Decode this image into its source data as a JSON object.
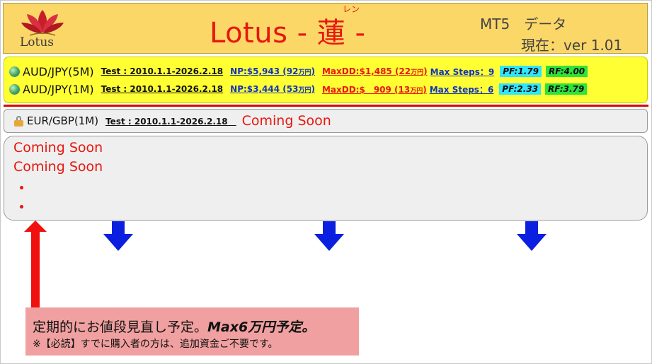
{
  "header": {
    "logo_text": "Lotus",
    "title": "Lotus - 蓮 -",
    "title_ruby": "レン",
    "platform": "MT5　データ",
    "version": "現在：ver 1.01"
  },
  "results": [
    {
      "pair": "AUD/JPY(5M)",
      "test": "Test : 2010.1.1-2026.2.18",
      "np_label": "NP:$5,943 (92",
      "np_unit": "万円",
      "np_close": ")",
      "dd_label": "MaxDD:$1,485 (22",
      "dd_unit": "万円",
      "dd_close": ")",
      "steps": "Max Steps：9",
      "pf": "PF:1.79",
      "rf": "RF:4.00"
    },
    {
      "pair": "AUD/JPY(1M)",
      "test": "Test : 2010.1.1-2026.2.18",
      "np_label": "NP:$3,444 (53",
      "np_unit": "万円",
      "np_close": ")",
      "dd_label": "MaxDD:$　909 (13",
      "dd_unit": "万円",
      "dd_close": ")",
      "steps": "Max Steps：6",
      "pf": "PF:2.33",
      "rf": "RF:3.79"
    }
  ],
  "locked": {
    "pair": "EUR/GBP(1M)",
    "test": "Test : 2010.1.1-2026.2.18　",
    "status": "Coming Soon"
  },
  "upcoming": {
    "line1": "Coming Soon",
    "line2": "Coming Soon"
  },
  "notice": {
    "text_main": "定期的にお値段見直し予定。",
    "text_bold": "Max6万円予定。",
    "text_sub": "※【必読】すでに購入者の方は、追加資金ご不要です。"
  },
  "colors": {
    "header_bg": "#fbd768",
    "title_red": "#e8160f",
    "data_bg": "#ffff33",
    "link_blue": "#1233bb",
    "pf_bg": "#2fe6ff",
    "rf_bg": "#2ee33c",
    "arrow_blue": "#0a1fe0",
    "arrow_red": "#f01010",
    "notice_bg": "#f0a0a0"
  },
  "icons": {
    "logo": "lotus-flower-icon",
    "pair": "globe-icon",
    "locked": "lock-icon",
    "down": "down-arrow-icon",
    "up": "up-arrow-icon"
  }
}
